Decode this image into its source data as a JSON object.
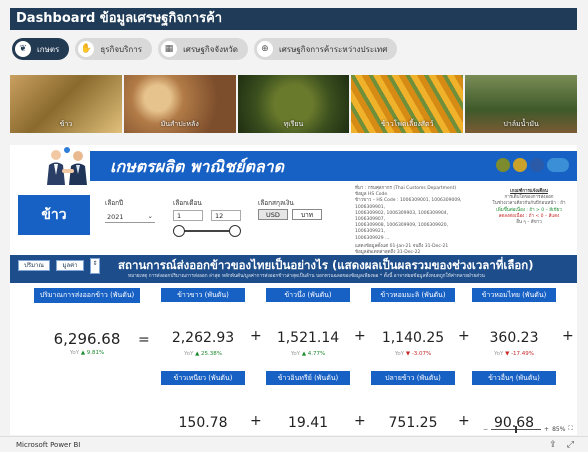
{
  "header": {
    "title": "Dashboard ข้อมูลเศรษฐกิจการค้า"
  },
  "tabs": [
    {
      "label": "เกษตร",
      "icon": "leaf-icon",
      "active": true
    },
    {
      "label": "ธุรกิจบริการ",
      "icon": "handshake-icon"
    },
    {
      "label": "เศรษฐกิจจังหวัด",
      "icon": "building-icon"
    },
    {
      "label": "เศรษฐกิจการค้าระหว่างประเทศ",
      "icon": "globe-icon"
    }
  ],
  "photos": [
    {
      "label": "ข้าว"
    },
    {
      "label": "มันสำปะหลัง"
    },
    {
      "label": "ทุเรียน"
    },
    {
      "label": "ข้าวโพดเลี้ยงสัตว์"
    },
    {
      "label": "ปาล์มน้ำมัน"
    }
  ],
  "banner": {
    "title": "เกษตรผลิต พาณิชย์ตลาด",
    "logos": [
      "#7b8b2d",
      "#caa22b",
      "#2a5aa8",
      "#3a8fd6"
    ]
  },
  "filters": {
    "product": "ข้าว",
    "year_label": "เลือกปี",
    "year_value": "2021",
    "month_label": "เลือกเดือน",
    "month_from": "1",
    "month_to": "12",
    "currency_label": "เลือกสกุลเงิน",
    "currency_usd": "USD",
    "currency_thb": "บาท"
  },
  "source": {
    "line1": "ที่มา : กรมศุลกากร (Thai Customs Department)",
    "line2": "ข้อมูล HS Code",
    "line3": "ข้าวขาว – HS Code : 1006309001, 1006309009, 1006309901,",
    "line4": "1006309902, 1006309903, 1006309904, 1006309907,",
    "line5": "1006309908, 1006309909, 1006309920, 1006309921,",
    "line6": "1006309929 ...",
    "line7": "แสดงข้อมูลตั้งแต่ 01-Jan-21 จนถึง 31-Dec-21",
    "line8": "ข้อมูลอัพเดทล่าสุดถึง 31-Dec-22"
  },
  "legend": {
    "title": "เกณฑ์การแจ้งเตือน",
    "line1": "การเติบโตของการส่งออก",
    "line2": "ในช่วงเวลาเดียวกันกับปีก่อนหน้า : ถ้า",
    "line3": "เพิ่มขึ้นต่อเนื่อง : ถ้า > 0 – สีเขียว",
    "line4": "ลดลงต่อเนื่อง : ถ้า < 0 – สีแดง",
    "line5": "อื่น ๆ – สีขาว"
  },
  "section": {
    "btn_qty": "ปริมาณ",
    "btn_val": "มูลค่า",
    "title": "สถานการณ์ส่งออกข้าวของไทยเป็นอย่างไร (แสดงผลเป็นผลรวมของช่วงเวลาที่เลือก)",
    "subtitle": "หมายเหตุ การส่งออกปริมาณการส่งออก ล่าสุด หลักพันตัน/มูลค่าการส่งออกข้าวล่าสุดเป็นล้าน บอกทวนฉลอของข้อมูลเพียงพอ * ตั้งนี้ อาจาห่ยอข้อมูลทั้งหมดถูกให้ค่าหลายฝ่ายส่วน"
  },
  "total": {
    "caption": "ปริมาณการส่งออกข้าว (พันตัน)",
    "value": "6,296.68",
    "yoy_label": "YoY",
    "yoy": "9.81%",
    "dir": "up"
  },
  "cards": [
    {
      "caption": "ข้าวขาว (พันตัน)",
      "value": "2,262.93",
      "yoy_label": "YoY",
      "yoy": "25.38%",
      "dir": "up"
    },
    {
      "caption": "ข้าวนึ่ง (พันตัน)",
      "value": "1,521.14",
      "yoy_label": "YoY",
      "yoy": "4.77%",
      "dir": "up"
    },
    {
      "caption": "ข้าวหอมมะลิ (พันตัน)",
      "value": "1,140.25",
      "yoy_label": "YoY",
      "yoy": "-3.07%",
      "dir": "down"
    },
    {
      "caption": "ข้าวหอมไทย (พันตัน)",
      "value": "360.23",
      "yoy_label": "YoY",
      "yoy": "-17.49%",
      "dir": "down"
    },
    {
      "caption": "ข้าวเหนียว (พันตัน)",
      "value": "150.78"
    },
    {
      "caption": "ข้าวอินทรีย์ (พันตัน)",
      "value": "19.41"
    },
    {
      "caption": "ปลายข้าว (พันตัน)",
      "value": "751.25"
    },
    {
      "caption": "ข้าวอื่นๆ (พันตัน)",
      "value": "90.68"
    }
  ],
  "operators": {
    "eq": "=",
    "plus": "+"
  },
  "zoom": {
    "level": "85%"
  },
  "footer": {
    "app": "Microsoft Power BI"
  }
}
